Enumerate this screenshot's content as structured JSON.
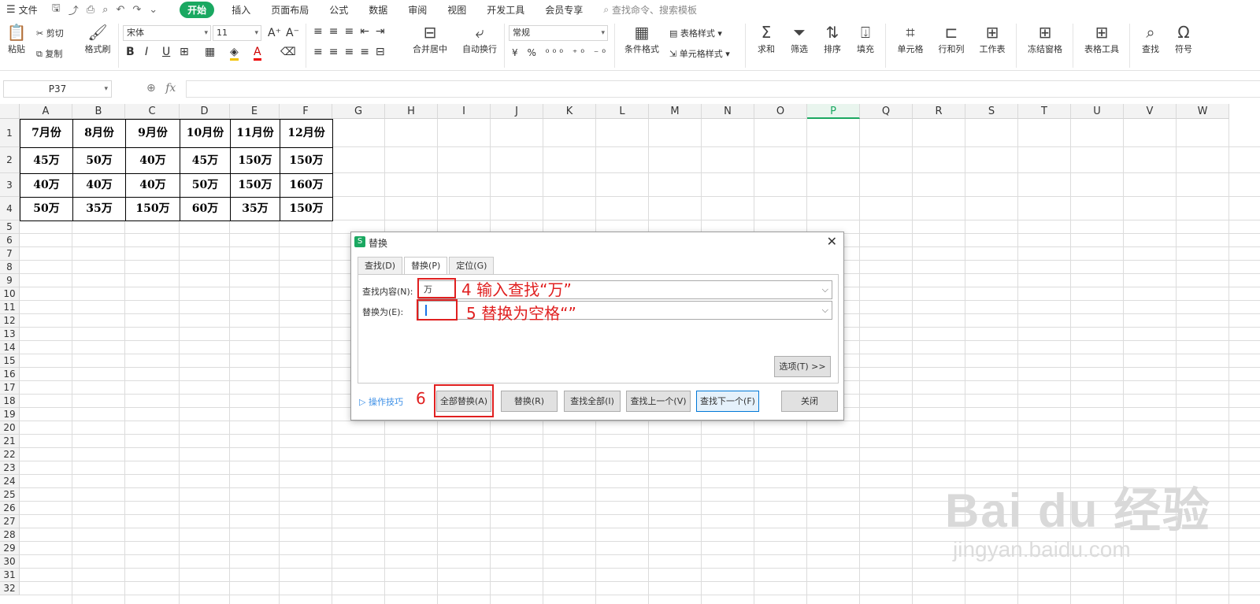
{
  "menubar": {
    "file": "文件",
    "tabs": [
      "开始",
      "插入",
      "页面布局",
      "公式",
      "数据",
      "审阅",
      "视图",
      "开发工具",
      "会员专享"
    ],
    "active_tab": "开始",
    "search_placeholder": "查找命令、搜索模板"
  },
  "ribbon": {
    "paste": "粘贴",
    "cut": "剪切",
    "copy": "复制",
    "format_painter": "格式刷",
    "font_name": "宋体",
    "font_size": "11",
    "merge_center": "合并居中",
    "wrap_text": "自动换行",
    "number_format": "常规",
    "cond_format": "条件格式",
    "table_style": "表格样式",
    "cell_style": "单元格样式",
    "sum": "求和",
    "filter": "筛选",
    "sort": "排序",
    "fill": "填充",
    "cell": "单元格",
    "row_col": "行和列",
    "worksheet": "工作表",
    "freeze": "冻结窗格",
    "table_tools": "表格工具",
    "find": "查找",
    "symbol": "符号"
  },
  "formula_bar": {
    "name_box": "P37",
    "fx": "fx",
    "value": ""
  },
  "sheet": {
    "columns": [
      "A",
      "B",
      "C",
      "D",
      "E",
      "F",
      "G",
      "H",
      "I",
      "J",
      "K",
      "L",
      "M",
      "N",
      "O",
      "P",
      "Q",
      "R",
      "S",
      "T",
      "U",
      "V",
      "W"
    ],
    "selected_column": "P",
    "rows": [
      "1",
      "2",
      "3",
      "4",
      "5",
      "6",
      "7",
      "8",
      "9",
      "10",
      "11",
      "12",
      "13",
      "14",
      "15",
      "16",
      "17",
      "18",
      "19",
      "20",
      "21",
      "22",
      "23",
      "24",
      "25",
      "26",
      "27",
      "28",
      "29",
      "30",
      "31",
      "32"
    ],
    "data": [
      [
        "7月份",
        "8月份",
        "9月份",
        "10月份",
        "11月份",
        "12月份"
      ],
      [
        "45万",
        "50万",
        "40万",
        "45万",
        "150万",
        "150万"
      ],
      [
        "40万",
        "40万",
        "40万",
        "50万",
        "150万",
        "160万"
      ],
      [
        "50万",
        "35万",
        "150万",
        "60万",
        "35万",
        "150万"
      ]
    ]
  },
  "dialog": {
    "title": "替换",
    "tabs": [
      "查找(D)",
      "替换(P)",
      "定位(G)"
    ],
    "active_tab": "替换(P)",
    "find_label": "查找内容(N):",
    "find_value": "万",
    "replace_label": "替换为(E):",
    "replace_value": "",
    "options_button": "选项(T) >>",
    "tips": "操作技巧",
    "buttons": {
      "replace_all": "全部替换(A)",
      "replace": "替换(R)",
      "find_all": "查找全部(I)",
      "find_prev": "查找上一个(V)",
      "find_next": "查找下一个(F)",
      "close": "关闭"
    }
  },
  "annotations": {
    "step4": "4 输入查找“万”",
    "step5": "5 替换为空格“”",
    "step6": "6"
  },
  "watermark": {
    "logo": "Bai du 经验",
    "url": "jingyan.baidu.com"
  }
}
